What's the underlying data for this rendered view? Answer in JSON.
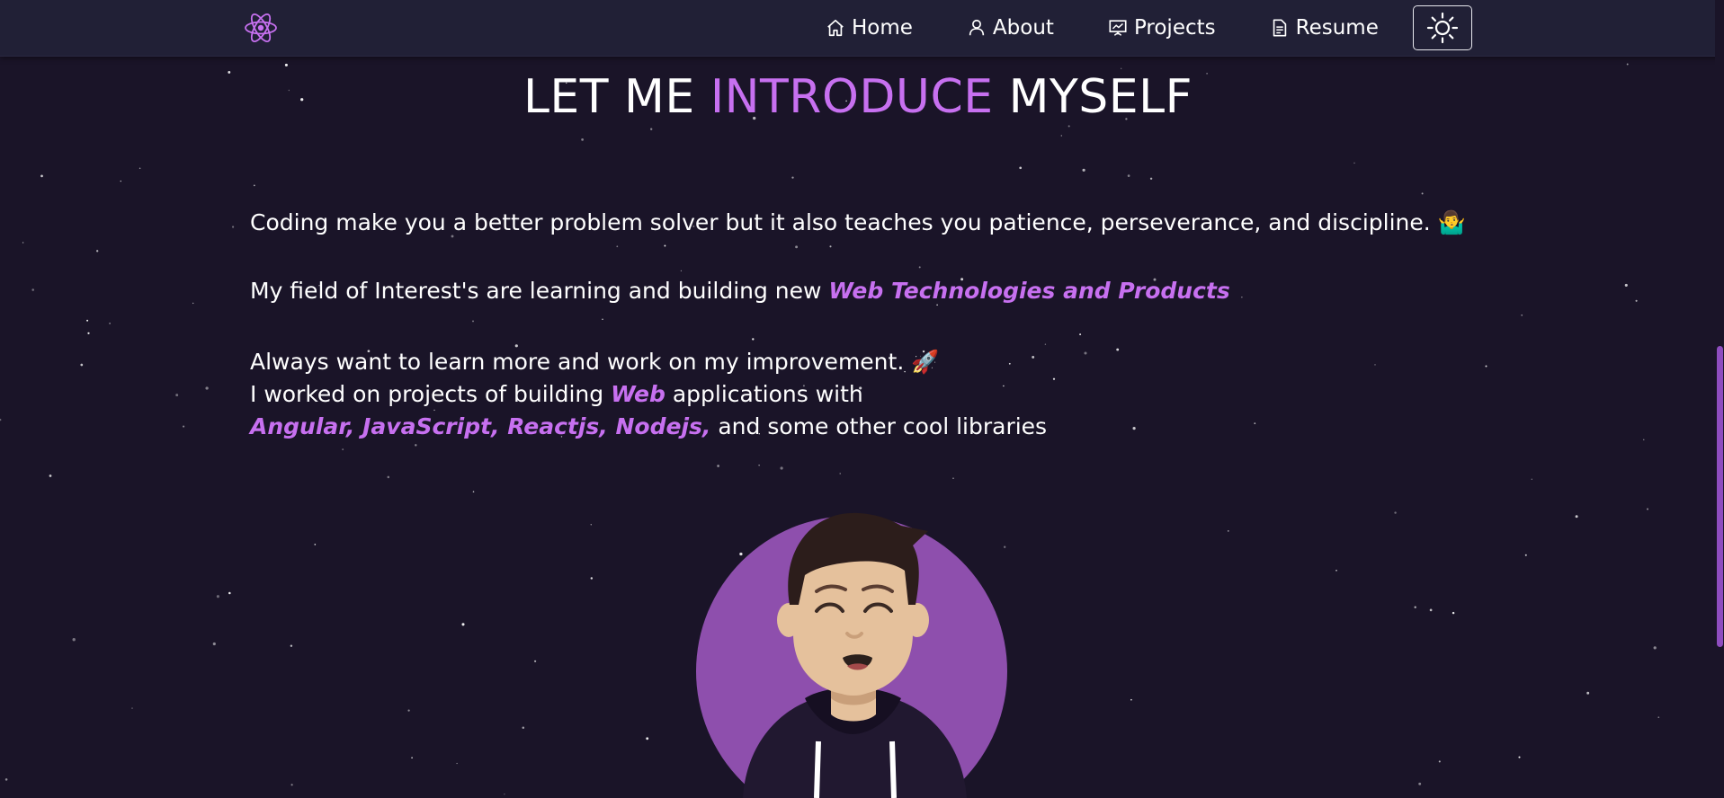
{
  "nav": {
    "logo_icon": "react-atom-icon",
    "items": [
      {
        "label": "Home",
        "icon": "home-icon"
      },
      {
        "label": "About",
        "icon": "user-icon"
      },
      {
        "label": "Projects",
        "icon": "presentation-icon"
      },
      {
        "label": "Resume",
        "icon": "document-icon"
      }
    ],
    "theme_toggle_icon": "sun-icon"
  },
  "heading": {
    "part1": "LET ME ",
    "highlight": "INTRODUCE",
    "part2": " MYSELF"
  },
  "paragraphs": {
    "p1": "Coding make you a better problem solver but it also teaches you patience, perseverance, and discipline. 🤷‍♂️",
    "p2_text": "My field of Interest's are learning and building new ",
    "p2_emph": "Web Technologies and Products",
    "p3_line1": "Always want to learn more and work on my improvement. 🚀",
    "p3_line2_a": "I worked on projects of building ",
    "p3_line2_emph": "Web",
    "p3_line2_b": " applications with",
    "p3_line3_emph": "Angular, JavaScript, Reactjs, Nodejs,",
    "p3_line3_b": " and some other cool libraries"
  },
  "colors": {
    "background": "#1a1428",
    "navbar": "#212036",
    "accent": "#c770f0",
    "avatar_circle": "#8e4fad"
  },
  "avatar_icon": "developer-avatar-illustration"
}
